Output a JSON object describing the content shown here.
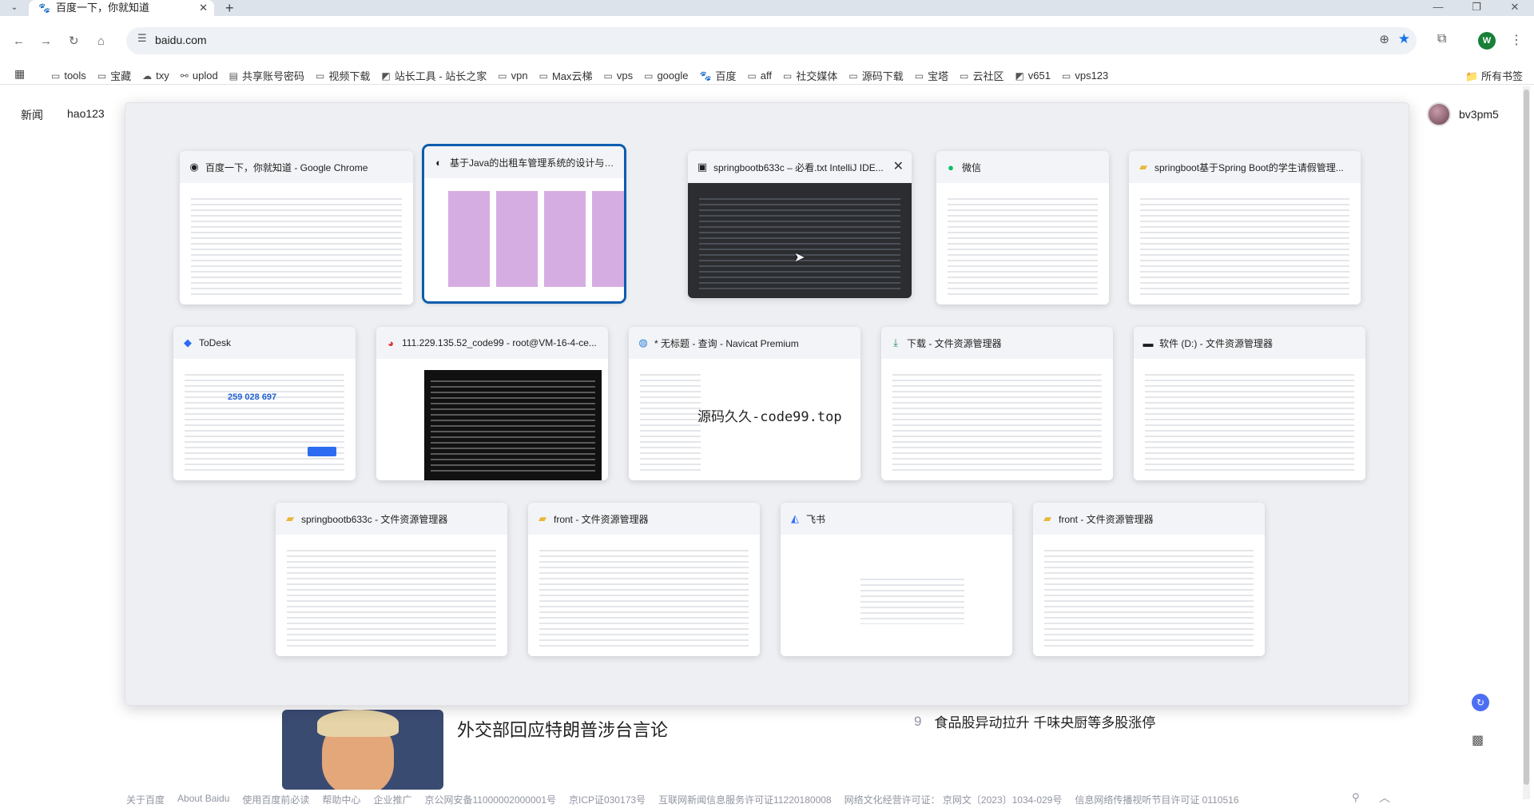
{
  "browser": {
    "active_tab": {
      "title": "百度一下，你就知道"
    },
    "url": "baidu.com",
    "profile_initial": "W",
    "bookmarks": [
      {
        "label": "tools",
        "icon": "folder-icon"
      },
      {
        "label": "宝藏",
        "icon": "folder-icon"
      },
      {
        "label": "txy",
        "icon": "cloud-icon"
      },
      {
        "label": "uplod",
        "icon": "link-icon"
      },
      {
        "label": "共享账号密码",
        "icon": "sheet-icon"
      },
      {
        "label": "视频下载",
        "icon": "folder-icon"
      },
      {
        "label": "站长工具 - 站长之家",
        "icon": "site-icon"
      },
      {
        "label": "vpn",
        "icon": "folder-icon"
      },
      {
        "label": "Max云梯",
        "icon": "folder-icon"
      },
      {
        "label": "vps",
        "icon": "folder-icon"
      },
      {
        "label": "google",
        "icon": "folder-icon"
      },
      {
        "label": "百度",
        "icon": "baidu-icon"
      },
      {
        "label": "aff",
        "icon": "folder-icon"
      },
      {
        "label": "社交媒体",
        "icon": "folder-icon"
      },
      {
        "label": "源码下载",
        "icon": "folder-icon"
      },
      {
        "label": "宝塔",
        "icon": "folder-icon"
      },
      {
        "label": "云社区",
        "icon": "folder-icon"
      },
      {
        "label": "v651",
        "icon": "site-icon"
      },
      {
        "label": "vps123",
        "icon": "folder-icon"
      }
    ],
    "all_bookmarks_label": "所有书签"
  },
  "baidu": {
    "nav": [
      "新闻",
      "hao123"
    ],
    "username": "bv3pm5",
    "news_headline": "外交部回应特朗普涉台言论",
    "hot_item": {
      "rank": "9",
      "text": "食品股异动拉升 千味央厨等多股涨停"
    },
    "footer": [
      "关于百度",
      "About Baidu",
      "使用百度前必读",
      "帮助中心",
      "企业推广",
      "京公网安备11000002000001号",
      "京ICP证030173号",
      "互联网新闻信息服务许可证11220180008",
      "网络文化经营许可证： 京网文〔2023〕1034-029号",
      "信息网络传播视听节目许可证 0110516"
    ]
  },
  "task_switcher": {
    "windows": [
      {
        "title": "百度一下，你就知道 - Google Chrome",
        "icon": "chrome-icon"
      },
      {
        "title": "基于Java的出租车管理系统的设计与实现 - ...",
        "icon": "edge-icon"
      },
      {
        "title": "springbootb633c – 必看.txt IntelliJ IDE...",
        "icon": "intellij-icon"
      },
      {
        "title": "微信",
        "icon": "wechat-icon"
      },
      {
        "title": "springboot基于Spring Boot的学生请假管理...",
        "icon": "folder-icon"
      },
      {
        "title": "ToDesk",
        "icon": "todesk-icon"
      },
      {
        "title": "111.229.135.52_code99 - root@VM-16-4-ce...",
        "icon": "terminal-icon"
      },
      {
        "title": "* 无标题 - 查询 - Navicat Premium",
        "icon": "navicat-icon"
      },
      {
        "title": "下载 - 文件资源管理器",
        "icon": "download-icon"
      },
      {
        "title": "软件 (D:) - 文件资源管理器",
        "icon": "drive-icon"
      },
      {
        "title": "springbootb633c - 文件资源管理器",
        "icon": "folder-icon"
      },
      {
        "title": "front - 文件资源管理器",
        "icon": "folder-icon"
      },
      {
        "title": "飞书",
        "icon": "feishu-icon"
      },
      {
        "title": "front - 文件资源管理器",
        "icon": "folder-icon"
      }
    ],
    "navicat_overlay_text": "源码久久-code99.top",
    "todesk_code": "259 028 697"
  },
  "colors": {
    "accent": "#0b5cad",
    "baidu_blue": "#4e6ef2",
    "star": "#1a73e8"
  }
}
